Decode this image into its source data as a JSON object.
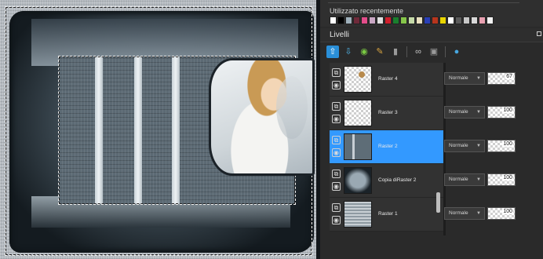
{
  "recent": {
    "title": "Utilizzato recentemente",
    "swatches": [
      "#ffffff",
      "#000000",
      "#9fb0bb",
      "#6e2a3a",
      "#e24d8a",
      "#c9a7c3",
      "#e0e0e0",
      "#cf1f2c",
      "#1a7f2e",
      "#86c54a",
      "#c5d9a8",
      "#e9e0c0",
      "#2a3fb5",
      "#b7351d",
      "#e8d400",
      "#ffffff",
      "#5b5b5b",
      "#c7c7c7",
      "#d8d8d8",
      "#e7a0b0",
      "#f2f2f2"
    ]
  },
  "layers_panel": {
    "title": "Livelli",
    "layers": [
      {
        "name": "Raster 4",
        "blend": "Normale",
        "opacity": "67",
        "selected": false,
        "thumb": "r4"
      },
      {
        "name": "Raster 3",
        "blend": "Normale",
        "opacity": "100",
        "selected": false,
        "thumb": "r3"
      },
      {
        "name": "Raster 2",
        "blend": "Normale",
        "opacity": "100",
        "selected": true,
        "thumb": "r2"
      },
      {
        "name": "Copia diRaster 2",
        "blend": "Normale",
        "opacity": "100",
        "selected": false,
        "thumb": "copy"
      },
      {
        "name": "Raster 1",
        "blend": "Normale",
        "opacity": "100",
        "selected": false,
        "thumb": "r1"
      }
    ]
  },
  "toolbar_icons": [
    "new-layer-icon",
    "new-mask-icon",
    "visibility-icon",
    "brush-icon",
    "delete-layer-icon",
    "link-icon",
    "lock-icon",
    "properties-icon"
  ]
}
